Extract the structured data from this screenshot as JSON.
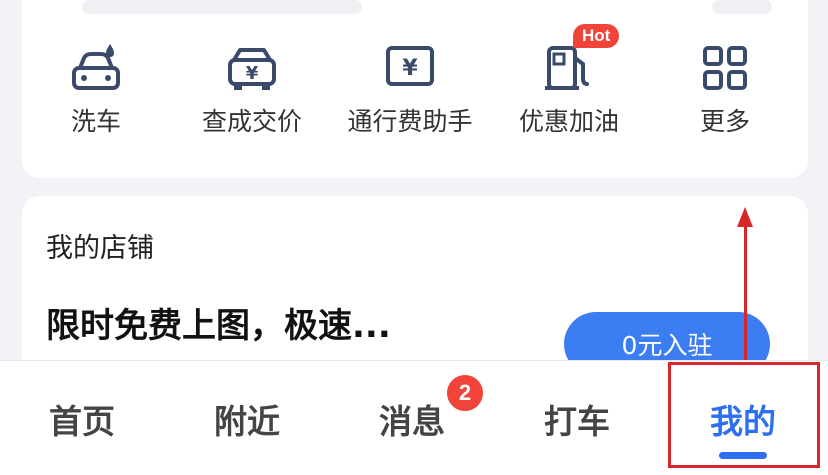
{
  "services": [
    {
      "label": "洗车",
      "icon": "car-wash-icon"
    },
    {
      "label": "查成交价",
      "icon": "car-price-icon"
    },
    {
      "label": "通行费助手",
      "icon": "toll-fee-icon"
    },
    {
      "label": "优惠加油",
      "icon": "fuel-pump-icon",
      "badge": "Hot"
    },
    {
      "label": "更多",
      "icon": "grid-more-icon"
    }
  ],
  "store": {
    "title": "我的店铺",
    "headline": "限时免费上图，极速...",
    "button": "0元入驻"
  },
  "tabs": [
    {
      "label": "首页"
    },
    {
      "label": "附近"
    },
    {
      "label": "消息",
      "badge": "2"
    },
    {
      "label": "打车"
    },
    {
      "label": "我的",
      "active": true
    }
  ],
  "colors": {
    "accent": "#2d6ff0",
    "annotation": "#d9262a",
    "badge": "#f0443a",
    "icon": "#3a4a6b"
  }
}
